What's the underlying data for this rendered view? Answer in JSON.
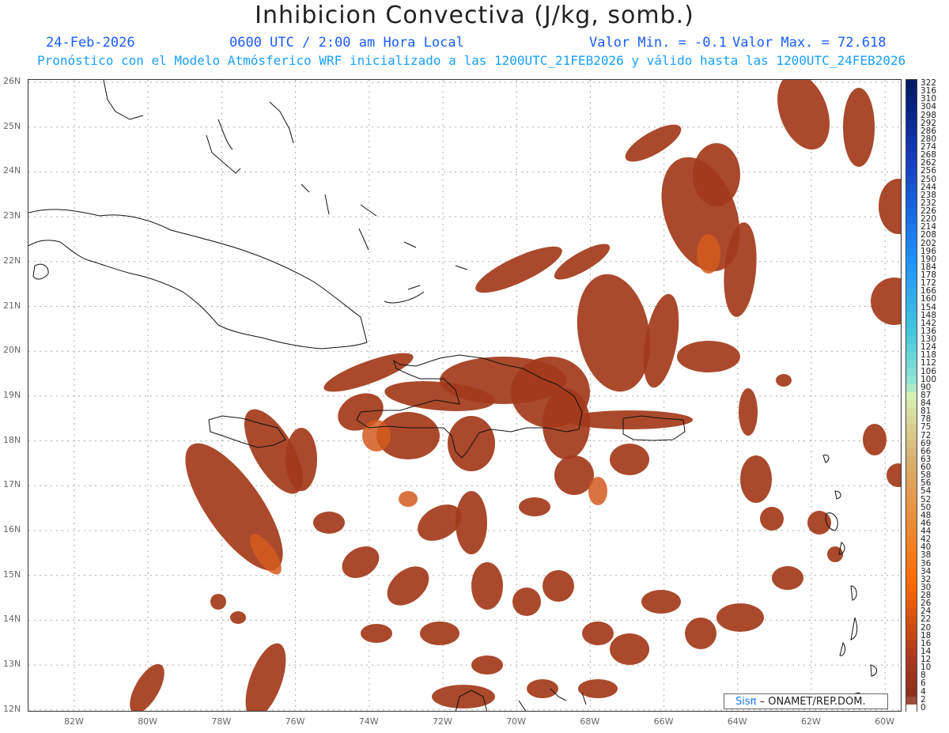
{
  "header": {
    "title": "Inhibicion Convectiva (J/kg, somb.)",
    "date": "24-Feb-2026",
    "time": "0600 UTC / 2:00 am Hora Local",
    "min_label": "Valor Min. = -0.1",
    "max_label": "Valor Max. = 72.618",
    "model_line": "Pronóstico con el Modelo Atmósferico WRF inicializado a las 1200UTC_21FEB2026 y válido hasta las  1200UTC_24FEB2026"
  },
  "axes": {
    "lat_labels": [
      "26N",
      "25N",
      "24N",
      "23N",
      "22N",
      "21N",
      "20N",
      "19N",
      "18N",
      "17N",
      "16N",
      "15N",
      "14N",
      "13N",
      "12N"
    ],
    "lon_labels": [
      "82W",
      "80W",
      "78W",
      "76W",
      "74W",
      "72W",
      "70W",
      "68W",
      "66W",
      "64W",
      "62W",
      "60W"
    ]
  },
  "colorbar": {
    "labels": [
      "322",
      "316",
      "310",
      "304",
      "298",
      "292",
      "286",
      "280",
      "274",
      "268",
      "262",
      "256",
      "250",
      "244",
      "238",
      "232",
      "226",
      "220",
      "214",
      "208",
      "202",
      "196",
      "190",
      "184",
      "178",
      "172",
      "166",
      "160",
      "154",
      "148",
      "142",
      "136",
      "130",
      "124",
      "118",
      "112",
      "106",
      "100",
      "90",
      "87",
      "84",
      "81",
      "78",
      "75",
      "72",
      "69",
      "66",
      "63",
      "60",
      "58",
      "56",
      "54",
      "52",
      "50",
      "48",
      "46",
      "44",
      "42",
      "40",
      "38",
      "36",
      "34",
      "32",
      "30",
      "28",
      "26",
      "24",
      "22",
      "20",
      "18",
      "16",
      "14",
      "12",
      "10",
      "8",
      "6",
      "4",
      "2",
      "0"
    ],
    "colors": {
      "high": "#001a66",
      "mid_blue": "#1e90ff",
      "cyan": "#7fe0e0",
      "light_green": "#d8f0b0",
      "tan": "#d8b070",
      "orange": "#ff6a00",
      "brown": "#8b2e1a",
      "zero": "#ffffff"
    }
  },
  "field_color": "#a33a1a",
  "credit": {
    "brand": "Sisπ",
    "org": " – ONAMET/REP.DOM."
  }
}
